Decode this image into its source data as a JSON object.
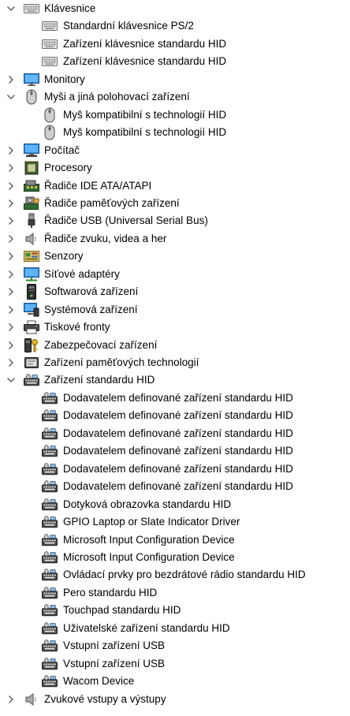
{
  "tree": [
    {
      "level": 0,
      "state": "expanded",
      "icon": "keyboard-icon",
      "name": "category-klavesnice",
      "label": "Klávesnice"
    },
    {
      "level": 1,
      "icon": "keyboard-icon",
      "name": "device-keyboard-ps2",
      "label": "Standardní klávesnice PS/2"
    },
    {
      "level": 1,
      "icon": "keyboard-icon",
      "name": "device-keyboard-hid",
      "label": "Zařízení klávesnice standardu HID"
    },
    {
      "level": 1,
      "icon": "keyboard-icon",
      "name": "device-keyboard-hid",
      "label": "Zařízení klávesnice standardu HID"
    },
    {
      "level": 0,
      "state": "collapsed",
      "icon": "monitor-icon",
      "name": "category-monitory",
      "label": "Monitory"
    },
    {
      "level": 0,
      "state": "expanded",
      "icon": "mouse-icon",
      "name": "category-mysi",
      "label": "Myši a jiná polohovací zařízení"
    },
    {
      "level": 1,
      "icon": "mouse-icon",
      "name": "device-mouse-hid",
      "label": "Myš kompatibilní s technologií HID"
    },
    {
      "level": 1,
      "icon": "mouse-icon",
      "name": "device-mouse-hid",
      "label": "Myš kompatibilní s technologií HID"
    },
    {
      "level": 0,
      "state": "collapsed",
      "icon": "computer-icon",
      "name": "category-pocitac",
      "label": "Počítač"
    },
    {
      "level": 0,
      "state": "collapsed",
      "icon": "processor-icon",
      "name": "category-procesory",
      "label": "Procesory"
    },
    {
      "level": 0,
      "state": "collapsed",
      "icon": "ide-controller-icon",
      "name": "category-radice-ide",
      "label": "Řadiče IDE ATA/ATAPI"
    },
    {
      "level": 0,
      "state": "collapsed",
      "icon": "storage-controller-icon",
      "name": "category-radice-pametovych-zarizeni",
      "label": "Řadiče paměťových zařízení"
    },
    {
      "level": 0,
      "state": "collapsed",
      "icon": "usb-icon",
      "name": "category-radice-usb",
      "label": "Řadiče USB (Universal Serial Bus)"
    },
    {
      "level": 0,
      "state": "collapsed",
      "icon": "speaker-icon",
      "name": "category-radice-zvuku",
      "label": "Řadiče zvuku, videa a her"
    },
    {
      "level": 0,
      "state": "collapsed",
      "icon": "sensor-icon",
      "name": "category-senzory",
      "label": "Senzory"
    },
    {
      "level": 0,
      "state": "collapsed",
      "icon": "network-adapter-icon",
      "name": "category-sitove-adaptery",
      "label": "Síťové adaptéry"
    },
    {
      "level": 0,
      "state": "collapsed",
      "icon": "software-device-icon",
      "name": "category-softwarova-zarizeni",
      "label": "Softwarová zařízení"
    },
    {
      "level": 0,
      "state": "collapsed",
      "icon": "system-device-icon",
      "name": "category-systemova-zarizeni",
      "label": "Systémová zařízení"
    },
    {
      "level": 0,
      "state": "collapsed",
      "icon": "printer-icon",
      "name": "category-tiskove-fronty",
      "label": "Tiskové fronty"
    },
    {
      "level": 0,
      "state": "collapsed",
      "icon": "security-key-icon",
      "name": "category-zabezpecovaci-zarizeni",
      "label": "Zabezpečovací zařízení"
    },
    {
      "level": 0,
      "state": "collapsed",
      "icon": "memory-technology-icon",
      "name": "category-zarizeni-pametovych-technologii",
      "label": "Zařízení paměťových technologií"
    },
    {
      "level": 0,
      "state": "expanded",
      "icon": "hid-icon",
      "name": "category-zarizeni-standardu-hid",
      "label": "Zařízení standardu HID"
    },
    {
      "level": 1,
      "icon": "hid-icon",
      "name": "device-hid-vendor-defined",
      "label": "Dodavatelem definované zařízení standardu HID"
    },
    {
      "level": 1,
      "icon": "hid-icon",
      "name": "device-hid-vendor-defined",
      "label": "Dodavatelem definované zařízení standardu HID"
    },
    {
      "level": 1,
      "icon": "hid-icon",
      "name": "device-hid-vendor-defined",
      "label": "Dodavatelem definované zařízení standardu HID"
    },
    {
      "level": 1,
      "icon": "hid-icon",
      "name": "device-hid-vendor-defined",
      "label": "Dodavatelem definované zařízení standardu HID"
    },
    {
      "level": 1,
      "icon": "hid-icon",
      "name": "device-hid-vendor-defined",
      "label": "Dodavatelem definované zařízení standardu HID"
    },
    {
      "level": 1,
      "icon": "hid-icon",
      "name": "device-hid-vendor-defined",
      "label": "Dodavatelem definované zařízení standardu HID"
    },
    {
      "level": 1,
      "icon": "hid-icon",
      "name": "device-hid-touchscreen",
      "label": "Dotyková obrazovka standardu HID"
    },
    {
      "level": 1,
      "icon": "hid-icon",
      "name": "device-gpio-indicator",
      "label": "GPIO Laptop or Slate Indicator Driver"
    },
    {
      "level": 1,
      "icon": "hid-icon",
      "name": "device-ms-input-config",
      "label": "Microsoft Input Configuration Device"
    },
    {
      "level": 1,
      "icon": "hid-icon",
      "name": "device-ms-input-config",
      "label": "Microsoft Input Configuration Device"
    },
    {
      "level": 1,
      "icon": "hid-icon",
      "name": "device-hid-radio-controls",
      "label": "Ovládací prvky pro bezdrátové rádio standardu HID"
    },
    {
      "level": 1,
      "icon": "hid-icon",
      "name": "device-hid-pen",
      "label": "Pero standardu HID"
    },
    {
      "level": 1,
      "icon": "hid-icon",
      "name": "device-hid-touchpad",
      "label": "Touchpad standardu HID"
    },
    {
      "level": 1,
      "icon": "hid-icon",
      "name": "device-hid-user-device",
      "label": "Uživatelské zařízení standardu HID"
    },
    {
      "level": 1,
      "icon": "hid-icon",
      "name": "device-usb-input",
      "label": "Vstupní zařízení USB"
    },
    {
      "level": 1,
      "icon": "hid-icon",
      "name": "device-usb-input",
      "label": "Vstupní zařízení USB"
    },
    {
      "level": 1,
      "icon": "hid-icon",
      "name": "device-wacom",
      "label": "Wacom Device"
    },
    {
      "level": 0,
      "state": "collapsed",
      "icon": "speaker-icon",
      "name": "category-zvukove-vstupy-vystupy",
      "label": "Zvukové vstupy a výstupy"
    }
  ],
  "colors": {
    "chevron": "#5a5a5a",
    "text": "#000000",
    "background": "#ffffff"
  }
}
